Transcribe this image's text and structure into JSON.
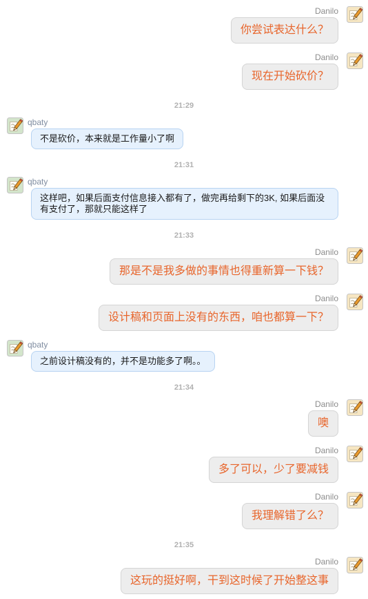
{
  "participants": {
    "Danilo": {
      "is_self": true,
      "avatar_icon": "pencil-icon",
      "avatar_color": "#f6e6c2",
      "name_color": "#8c8c8c",
      "bubble_color": "#ededed",
      "bubble_border": "#d4d4d4",
      "text_color": "#e8652b"
    },
    "qbaty": {
      "is_self": false,
      "avatar_icon": "pencil-icon",
      "avatar_color": "#d3e5cb",
      "name_color": "#7f8ca0",
      "bubble_color": "#e6f1fd",
      "bubble_border": "#b7d3f2",
      "text_color": "#1a1a1a"
    }
  },
  "messages": [
    {
      "sender": "Danilo",
      "text": "你尝试表达什么？"
    },
    {
      "sender": "Danilo",
      "text": "现在开始砍价？"
    },
    {
      "time": "21:29"
    },
    {
      "sender": "qbaty",
      "text": "不是砍价，本来就是工作量小了啊"
    },
    {
      "time": "21:31"
    },
    {
      "sender": "qbaty",
      "text": "这样吧，如果后面支付信息接入都有了，做完再给剩下的3K, 如果后面没有支付了，那就只能这样了"
    },
    {
      "time": "21:33"
    },
    {
      "sender": "Danilo",
      "text": "那是不是我多做的事情也得重新算一下钱？"
    },
    {
      "sender": "Danilo",
      "text": "设计稿和页面上没有的东西，咱也都算一下？"
    },
    {
      "sender": "qbaty",
      "text": "之前设计稿没有的，并不是功能多了啊。。"
    },
    {
      "time": "21:34"
    },
    {
      "sender": "Danilo",
      "text": "噢"
    },
    {
      "sender": "Danilo",
      "text": "多了可以，少了要减钱"
    },
    {
      "sender": "Danilo",
      "text": "我理解错了么？"
    },
    {
      "time": "21:35"
    },
    {
      "sender": "Danilo",
      "text": "这玩的挺好啊，干到这时候了开始整这事"
    }
  ]
}
